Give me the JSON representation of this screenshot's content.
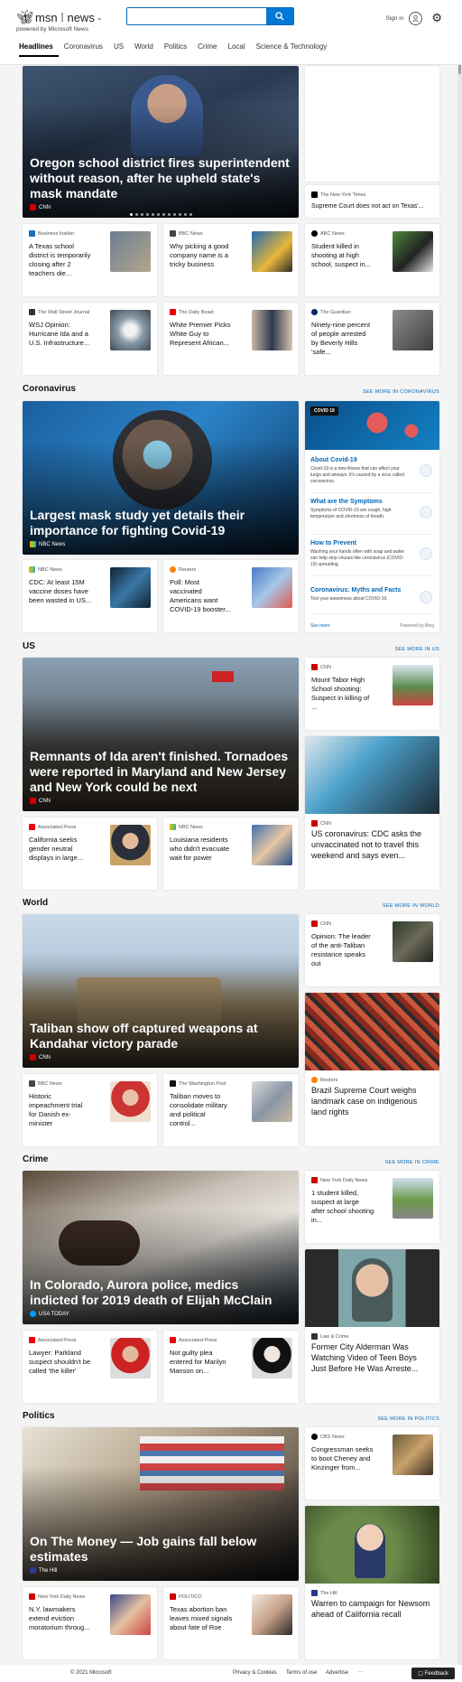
{
  "header": {
    "logo_brand": "msn",
    "logo_product": "news",
    "logo_sub": "powered by Microsoft News",
    "search_placeholder": "",
    "signin": "Sign in"
  },
  "nav": [
    "Headlines",
    "Coronavirus",
    "US",
    "World",
    "Politics",
    "Crime",
    "Local",
    "Science & Technology"
  ],
  "headlines": {
    "hero": {
      "title": "Oregon school district fires superintendent without reason, after he upheld state's mask mandate",
      "source": "CNN"
    },
    "side": {
      "source": "The New York Times",
      "title": "Supreme Court does not act on Texas'..."
    },
    "row1": [
      {
        "source": "Business Insider",
        "title": "A Texas school district is temporarily closing after 2 teachers die..."
      },
      {
        "source": "BBC News",
        "title": "Why picking a good company name is a tricky business"
      },
      {
        "source": "ABC News",
        "title": "Student killed in shooting at high school, suspect in..."
      }
    ],
    "row2": [
      {
        "source": "The Wall Street Journal",
        "title": "WSJ Opinion: Hurricane Ida and a U.S. Infrastructure..."
      },
      {
        "source": "The Daily Beast",
        "title": "White Premier Picks White Guy to Represent African..."
      },
      {
        "source": "The Guardian",
        "title": "Ninety-nine percent of people arrested by Beverly Hills 'safe..."
      }
    ]
  },
  "coronavirus": {
    "section_title": "Coronavirus",
    "more": "SEE MORE IN CORONAVIRUS",
    "hero": {
      "title": "Largest mask study yet details their importance for fighting Covid-19",
      "source": "NBC News"
    },
    "panel": {
      "badge": "COVID 19",
      "items": [
        {
          "title": "About Covid-19",
          "desc": "Covid-19 is a new illness that can affect your lungs and airways. It's caused by a virus called coronavirus."
        },
        {
          "title": "What are the Symptoms",
          "desc": "Symptoms of COVID-19 are cough, high temperature and shortness of breath."
        },
        {
          "title": "How to Prevent",
          "desc": "Washing your hands often with soap and water can help stop viruses like coronavirus (COVID-19) spreading."
        },
        {
          "title": "Coronavirus: Myths and Facts",
          "desc": "Test your awareness about COVID-19."
        }
      ],
      "see_more": "See more",
      "powered": "Powered by Bing"
    },
    "row": [
      {
        "source": "NBC News",
        "title": "CDC: At least 15M vaccine doses have been wasted in US..."
      },
      {
        "source": "Reuters",
        "title": "Poll: Most vaccinated Americans want COVID-19 booster..."
      }
    ]
  },
  "us": {
    "section_title": "US",
    "more": "SEE MORE IN US",
    "hero": {
      "title": "Remnants of Ida aren't finished. Tornadoes were reported in Maryland and New Jersey and New York could be next",
      "source": "CNN"
    },
    "side_small": {
      "source": "CNN",
      "title": "Mount Tabor High School shooting: Suspect in killing of ..."
    },
    "side_tall": {
      "source": "CNN",
      "title": "US coronavirus: CDC asks the unvaccinated not to travel this weekend and says even..."
    },
    "row": [
      {
        "source": "Associated Press",
        "title": "California seeks gender neutral displays in large..."
      },
      {
        "source": "NBC News",
        "title": "Louisiana residents who didn't evacuate wait for power"
      }
    ]
  },
  "world": {
    "section_title": "World",
    "more": "SEE MORE IN WORLD",
    "hero": {
      "title": "Taliban show off captured weapons at Kandahar victory parade",
      "source": "CNN"
    },
    "side_small": {
      "source": "CNN",
      "title": "Opinion: The leader of the anti-Taliban resistance speaks out"
    },
    "side_tall": {
      "source": "Reuters",
      "title": "Brazil Supreme Court weighs landmark case on indigenous land rights"
    },
    "row": [
      {
        "source": "BBC News",
        "title": "Historic impeachment trial for Danish ex-minister"
      },
      {
        "source": "The Washington Post",
        "title": "Taliban moves to consolidate military and political control..."
      }
    ]
  },
  "crime": {
    "section_title": "Crime",
    "more": "SEE MORE IN CRIME",
    "hero": {
      "title": "In Colorado, Aurora police, medics indicted for 2019 death of Elijah McClain",
      "source": "USA TODAY"
    },
    "side_small": {
      "source": "New York Daily News",
      "title": "1 student killed, suspect at large after school shooting in..."
    },
    "side_tall": {
      "source": "Law & Crime",
      "title": "Former City Alderman Was Watching Video of Teen Boys Just Before He Was Arreste..."
    },
    "row": [
      {
        "source": "Associated Press",
        "title": "Lawyer: Parkland suspect shouldn't be called 'the killer'"
      },
      {
        "source": "Associated Press",
        "title": "Not guilty plea entered for Marilyn Manson on..."
      }
    ]
  },
  "politics": {
    "section_title": "Politics",
    "more": "SEE MORE IN POLITICS",
    "hero": {
      "title": "On The Money — Job gains fall below estimates",
      "source": "The Hill"
    },
    "side_small": {
      "source": "CBS News",
      "title": "Congressman seeks to boot Cheney and Kinzinger from..."
    },
    "side_tall": {
      "source": "The Hill",
      "title": "Warren to campaign for Newsom ahead of California recall"
    },
    "row": [
      {
        "source": "New York Daily News",
        "title": "N.Y. lawmakers extend eviction moratorium throug..."
      },
      {
        "source": "POLITICO",
        "title": "Texas abortion ban leaves mixed signals about fate of Roe"
      }
    ]
  },
  "footer": {
    "copyright": "© 2021 Microsoft",
    "privacy": "Privacy & Cookies",
    "terms": "Terms of use",
    "advertise": "Advertise",
    "more": "···",
    "feedback": "Feedback"
  }
}
